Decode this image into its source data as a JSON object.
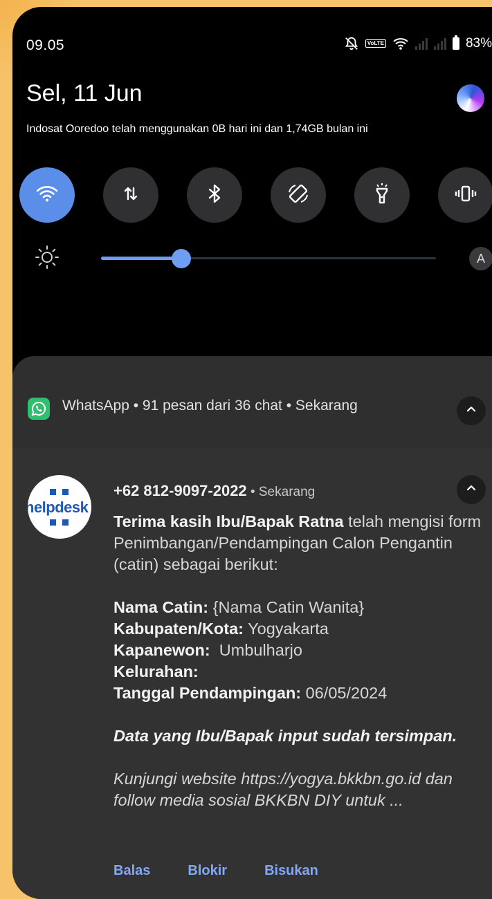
{
  "status": {
    "time": "09.05",
    "volte": "VoLTE",
    "battery_percent": "83%",
    "battery_level": 83
  },
  "header": {
    "date": "Sel, 11 Jun",
    "data_usage": "Indosat Ooredoo telah menggunakan 0B hari ini dan 1,74GB bulan ini"
  },
  "quick_settings": {
    "tiles": [
      {
        "icon": "wifi-icon",
        "active": true
      },
      {
        "icon": "mobile-data-icon",
        "active": false
      },
      {
        "icon": "bluetooth-icon",
        "active": false
      },
      {
        "icon": "auto-rotate-icon",
        "active": false
      },
      {
        "icon": "flashlight-icon",
        "active": false
      },
      {
        "icon": "vibrate-icon",
        "active": false
      }
    ],
    "brightness_level": 0.24,
    "auto_label": "A"
  },
  "notification_group": {
    "app": "WhatsApp",
    "summary": "91 pesan dari 36 chat",
    "time": "Sekarang",
    "title_line": "WhatsApp • 91 pesan dari 36 chat • Sekarang"
  },
  "notification": {
    "avatar_text": "helpdesk",
    "sender": "+62 812-9097-2022",
    "meta": " • Sekarang",
    "message": {
      "intro_bold": "Terima kasih Ibu/Bapak Ratna",
      "intro_rest": " telah mengisi form Penimbangan/Pendampingan Calon Pengantin (catin) sebagai berikut:",
      "fields": [
        {
          "label": "Nama Catin:",
          "value": " {Nama Catin Wanita}"
        },
        {
          "label": "Kabupaten/Kota:",
          "value": " Yogyakarta"
        },
        {
          "label": "Kapanewon:",
          "value": "  Umbulharjo"
        },
        {
          "label": "Kelurahan:",
          "value": ""
        },
        {
          "label": "Tanggal Pendampingan:",
          "value": " 06/05/2024"
        }
      ],
      "saved": "Data yang Ibu/Bapak input sudah tersimpan.",
      "visit": "Kunjungi website https://yogya.bkkbn.go.id dan follow media sosial BKKBN DIY untuk ..."
    },
    "actions": [
      "Balas",
      "Blokir",
      "Bisukan"
    ]
  },
  "colors": {
    "accent": "#5a8ee8",
    "action_link": "#82a9f7",
    "whatsapp": "#2fbf71",
    "page_bg": "#f6c36a"
  }
}
